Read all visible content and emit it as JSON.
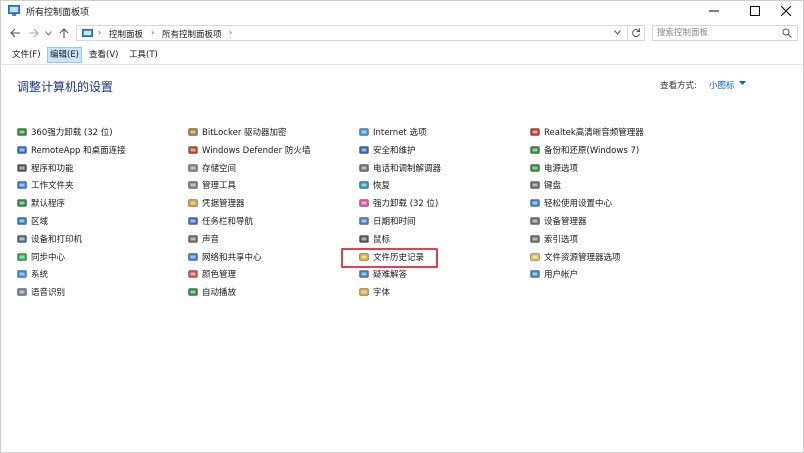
{
  "window": {
    "title": "所有控制面板项",
    "minimize_icon": "minimize-icon",
    "maximize_icon": "maximize-icon",
    "close_icon": "close-icon"
  },
  "address_bar": {
    "breadcrumbs": [
      "控制面板",
      "所有控制面板项"
    ],
    "separator": "›"
  },
  "search": {
    "placeholder": "搜索控制面板"
  },
  "menu": {
    "file": "文件(F)",
    "edit": "编辑(E)",
    "view": "查看(V)",
    "tools": "工具(T)"
  },
  "header": {
    "title": "调整计算机的设置",
    "view_by_label": "查看方式:",
    "view_mode": "小图标"
  },
  "items": {
    "col1": [
      {
        "label": "360强力卸载 (32 位)",
        "icon": "uninstall-icon",
        "color": "#2e8b3a"
      },
      {
        "label": "RemoteApp 和桌面连接",
        "icon": "remote-desktop-icon",
        "color": "#2f6fc4"
      },
      {
        "label": "程序和功能",
        "icon": "programs-icon",
        "color": "#555555"
      },
      {
        "label": "工作文件夹",
        "icon": "work-folders-icon",
        "color": "#3a7bd5"
      },
      {
        "label": "默认程序",
        "icon": "default-programs-icon",
        "color": "#2f8a3f"
      },
      {
        "label": "区域",
        "icon": "region-icon",
        "color": "#2d7fb8"
      },
      {
        "label": "设备和打印机",
        "icon": "printer-icon",
        "color": "#4a6b8a"
      },
      {
        "label": "同步中心",
        "icon": "sync-center-icon",
        "color": "#2ea84a"
      },
      {
        "label": "系统",
        "icon": "system-icon",
        "color": "#3d8bd6"
      },
      {
        "label": "语音识别",
        "icon": "microphone-icon",
        "color": "#6f7f8f"
      }
    ],
    "col2": [
      {
        "label": "BitLocker 驱动器加密",
        "icon": "bitlocker-icon",
        "color": "#a37d3a"
      },
      {
        "label": "Windows Defender 防火墙",
        "icon": "firewall-icon",
        "color": "#b5452f"
      },
      {
        "label": "存储空间",
        "icon": "storage-spaces-icon",
        "color": "#7f7f7f"
      },
      {
        "label": "管理工具",
        "icon": "admin-tools-icon",
        "color": "#7a7a7a"
      },
      {
        "label": "凭据管理器",
        "icon": "credential-manager-icon",
        "color": "#c9a13a"
      },
      {
        "label": "任务栏和导航",
        "icon": "taskbar-icon",
        "color": "#3a6fb0"
      },
      {
        "label": "声音",
        "icon": "sound-icon",
        "color": "#6a6a6a"
      },
      {
        "label": "网络和共享中心",
        "icon": "network-icon",
        "color": "#3a7fc1"
      },
      {
        "label": "颜色管理",
        "icon": "color-management-icon",
        "color": "#c0504d"
      },
      {
        "label": "自动播放",
        "icon": "autoplay-icon",
        "color": "#2f8a3f"
      }
    ],
    "col3": [
      {
        "label": "Internet 选项",
        "icon": "internet-options-icon",
        "color": "#3f8fcf"
      },
      {
        "label": "安全和维护",
        "icon": "security-flag-icon",
        "color": "#2f5fb3"
      },
      {
        "label": "电话和调制解调器",
        "icon": "phone-modem-icon",
        "color": "#6f6f6f"
      },
      {
        "label": "恢复",
        "icon": "recovery-icon",
        "color": "#2f8fbf"
      },
      {
        "label": "强力卸载 (32 位)",
        "icon": "uninstall-colorful-icon",
        "color": "#d94f9c"
      },
      {
        "label": "日期和时间",
        "icon": "clock-icon",
        "color": "#4a7fb5"
      },
      {
        "label": "鼠标",
        "icon": "mouse-icon",
        "color": "#555555"
      },
      {
        "label": "文件历史记录",
        "icon": "file-history-icon",
        "color": "#d6a93a"
      },
      {
        "label": "疑难解答",
        "icon": "troubleshooting-icon",
        "color": "#3a7fc1"
      },
      {
        "label": "字体",
        "icon": "fonts-icon",
        "color": "#d6a93a"
      }
    ],
    "col4": [
      {
        "label": "Realtek高清晰音频管理器",
        "icon": "realtek-audio-icon",
        "color": "#c0392b"
      },
      {
        "label": "备份和还原(Windows 7)",
        "icon": "backup-icon",
        "color": "#2f8a3f"
      },
      {
        "label": "电源选项",
        "icon": "power-options-icon",
        "color": "#2f8a3f"
      },
      {
        "label": "键盘",
        "icon": "keyboard-icon",
        "color": "#6a6a6a"
      },
      {
        "label": "轻松使用设置中心",
        "icon": "ease-of-access-icon",
        "color": "#3a7fc1"
      },
      {
        "label": "设备管理器",
        "icon": "device-manager-icon",
        "color": "#6a6a6a"
      },
      {
        "label": "索引选项",
        "icon": "indexing-icon",
        "color": "#6a6a6a"
      },
      {
        "label": "文件资源管理器选项",
        "icon": "explorer-options-icon",
        "color": "#e0b84a"
      },
      {
        "label": "用户帐户",
        "icon": "user-accounts-icon",
        "color": "#3a7fc1"
      }
    ]
  },
  "highlight_color": "#e3414d"
}
